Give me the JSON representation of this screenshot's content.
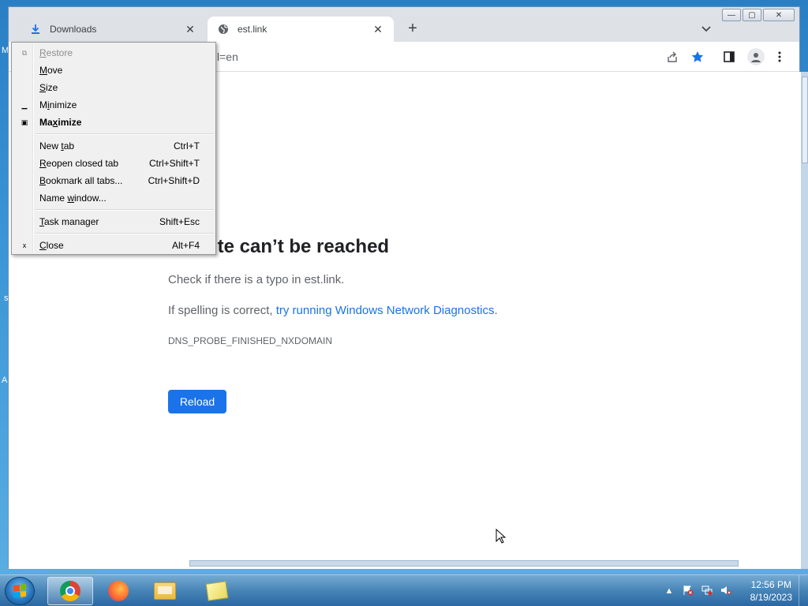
{
  "desktop": {
    "edge_letters": [
      "M",
      "s",
      "A"
    ]
  },
  "tabs": [
    {
      "title": "Downloads",
      "icon": "download-icon"
    },
    {
      "title": "est.link",
      "icon": "globe-icon"
    }
  ],
  "new_tab_symbol": "+",
  "tab_search_symbol": "⌄",
  "window_controls": {
    "minimize": "—",
    "maximize": "▢",
    "close": "✕"
  },
  "toolbar": {
    "address_fragment": "l=en",
    "icons": [
      "share-icon",
      "bookmark-star-icon",
      "side-panel-icon",
      "profile-icon",
      "more-menu-icon"
    ]
  },
  "error_page": {
    "title_visible": "ite can’t be reached",
    "line1": "Check if there is a typo in est.link.",
    "line2_prefix": "If spelling is correct, ",
    "line2_link": "try running Windows Network Diagnostics",
    "line2_suffix": ".",
    "code": "DNS_PROBE_FINISHED_NXDOMAIN",
    "reload_label": "Reload"
  },
  "system_menu": {
    "items": [
      {
        "label": "Restore",
        "accel": "",
        "glyph": "⧉",
        "disabled": true,
        "bold": false
      },
      {
        "label": "Move",
        "accel": "",
        "glyph": "",
        "disabled": false,
        "bold": false
      },
      {
        "label": "Size",
        "accel": "",
        "glyph": "",
        "disabled": false,
        "bold": false
      },
      {
        "label": "Minimize",
        "accel": "",
        "glyph": "▁",
        "disabled": false,
        "bold": false
      },
      {
        "label": "Maximize",
        "accel": "",
        "glyph": "▣",
        "disabled": false,
        "bold": true
      },
      {
        "label": "New tab",
        "accel": "Ctrl+T",
        "glyph": "",
        "disabled": false,
        "bold": false
      },
      {
        "label": "Reopen closed tab",
        "accel": "Ctrl+Shift+T",
        "glyph": "",
        "disabled": false,
        "bold": false
      },
      {
        "label": "Bookmark all tabs...",
        "accel": "Ctrl+Shift+D",
        "glyph": "",
        "disabled": false,
        "bold": false
      },
      {
        "label": "Name window...",
        "accel": "",
        "glyph": "",
        "disabled": false,
        "bold": false
      },
      {
        "label": "Task manager",
        "accel": "Shift+Esc",
        "glyph": "",
        "disabled": false,
        "bold": false
      },
      {
        "label": "Close",
        "accel": "Alt+F4",
        "glyph": "x",
        "disabled": false,
        "bold": false
      }
    ]
  },
  "taskbar": {
    "apps": [
      "chrome-icon",
      "firefox-icon",
      "file-explorer-icon",
      "sticky-notes-icon"
    ],
    "tray_icons": [
      "show-hidden-icons-arrow",
      "action-center-flag-icon",
      "network-icon",
      "volume-muted-icon"
    ],
    "time": "12:56 PM",
    "date": "8/19/2023"
  },
  "colors": {
    "accent": "#1a73e8",
    "tabstrip_bg": "#dee1e6",
    "menu_bg": "#f0f0f0"
  }
}
